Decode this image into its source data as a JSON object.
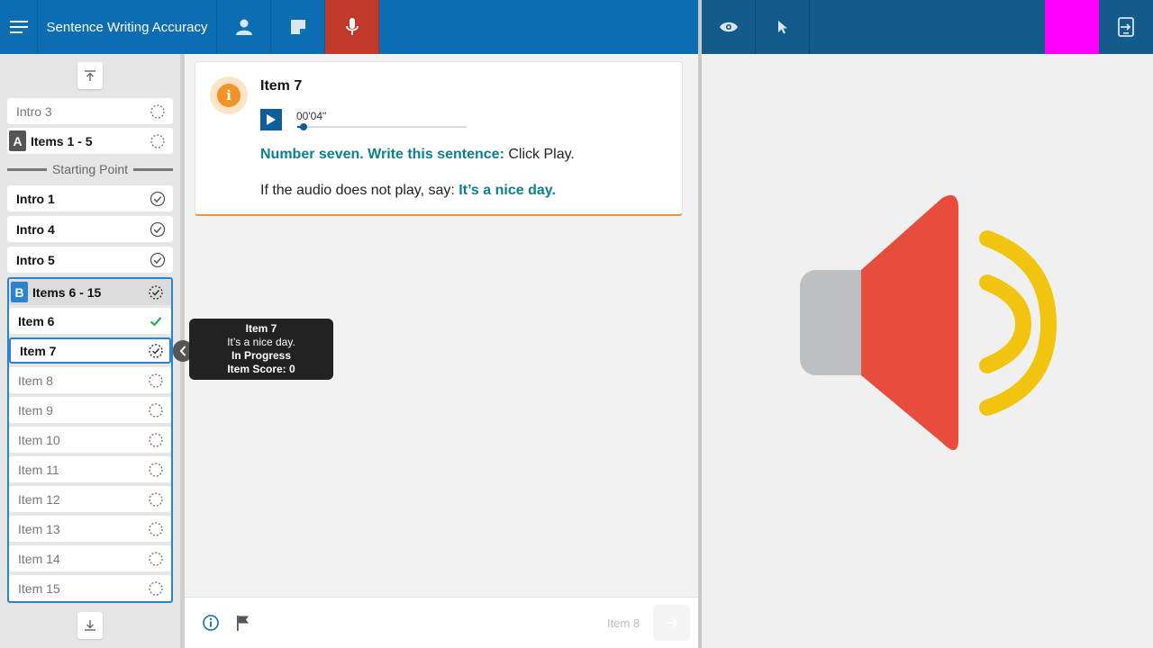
{
  "header": {
    "title": "Sentence Writing Accuracy",
    "magenta_color": "#ff00ff"
  },
  "sidebar": {
    "intro3": "Intro 3",
    "sectionA": {
      "badge": "A",
      "label": "Items 1 - 5"
    },
    "starting_point": "Starting Point",
    "intro1": "Intro 1",
    "intro4": "Intro 4",
    "intro5": "Intro 5",
    "sectionB": {
      "badge": "B",
      "label": "Items 6 - 15"
    },
    "items": [
      {
        "label": "Item 6",
        "status": "correct"
      },
      {
        "label": "Item 7",
        "status": "in-progress"
      },
      {
        "label": "Item 8",
        "status": "not-started"
      },
      {
        "label": "Item 9",
        "status": "not-started"
      },
      {
        "label": "Item 10",
        "status": "not-started"
      },
      {
        "label": "Item 11",
        "status": "not-started"
      },
      {
        "label": "Item 12",
        "status": "not-started"
      },
      {
        "label": "Item 13",
        "status": "not-started"
      },
      {
        "label": "Item 14",
        "status": "not-started"
      },
      {
        "label": "Item 15",
        "status": "not-started"
      }
    ]
  },
  "tooltip": {
    "title": "Item 7",
    "sentence": "It’s a nice day.",
    "status": "In Progress",
    "score": "Item Score: 0"
  },
  "card": {
    "title": "Item 7",
    "audio_time": "00'04\"",
    "audio_progress": 0.02,
    "instruction_bold": "Number seven. Write this sentence:",
    "instruction_rest": " Click Play.",
    "fallback_prefix": "If the audio does not play, say: ",
    "fallback_sentence": "It’s a nice day."
  },
  "footer": {
    "next_label": "Item 8"
  },
  "colors": {
    "primary": "#0d6db3",
    "accent_orange": "#f39325",
    "teal": "#0e7f8f",
    "speaker_red": "#e74c3c",
    "speaker_yellow": "#f1c40f",
    "speaker_gray": "#bdc0c3"
  }
}
